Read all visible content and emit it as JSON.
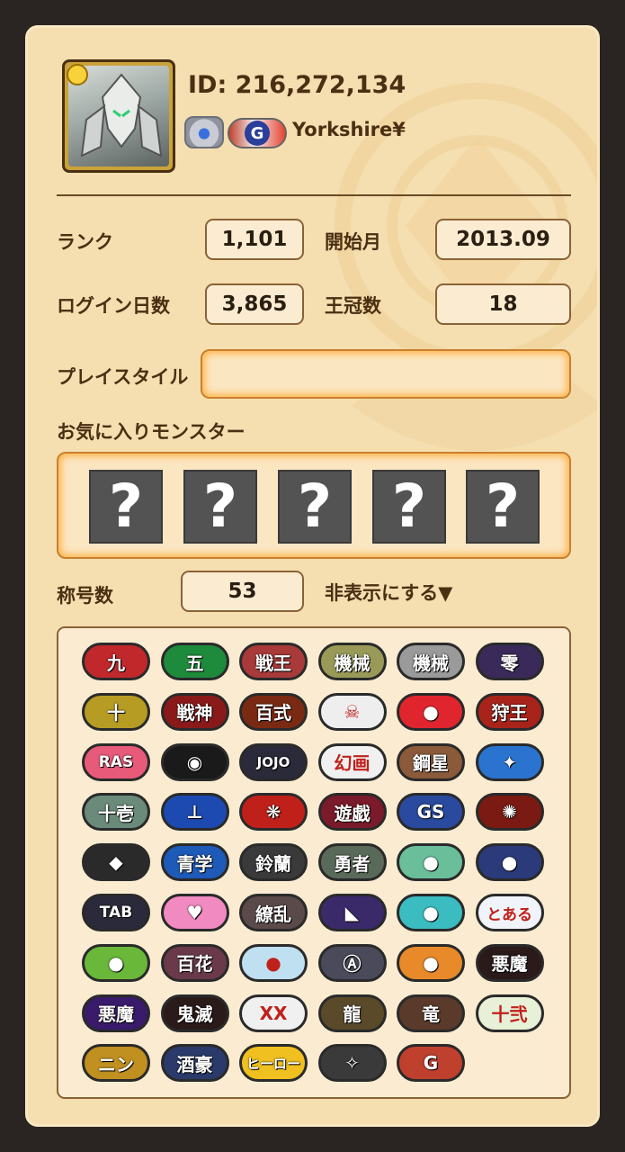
{
  "profile": {
    "id_text": "ID: 216,272,134",
    "name": "Yorkshire¥",
    "avatar_icon": "mecha-dragon-monster-icon",
    "badge_a_icon": "crown-medal-icon",
    "badge_g_icon": "g-emblem-icon",
    "badge_g_letter": "G"
  },
  "stats": {
    "rank_label": "ランク",
    "rank_value": "1,101",
    "start_label": "開始月",
    "start_value": "2013.09",
    "login_label": "ログイン日数",
    "login_value": "3,865",
    "crown_label": "王冠数",
    "crown_value": "18"
  },
  "playstyle": {
    "label": "プレイスタイル",
    "value": ""
  },
  "favorites": {
    "label": "お気に入りモンスター",
    "slots": [
      "?",
      "?",
      "?",
      "?",
      "?"
    ]
  },
  "titles": {
    "count_label": "称号数",
    "count_value": "53",
    "toggle_label": "非表示にする▼",
    "badges": [
      {
        "text": "九",
        "bg": "#c0282c"
      },
      {
        "text": "五",
        "bg": "#1e8a3c"
      },
      {
        "text": "戦王",
        "bg": "#a83a3a"
      },
      {
        "text": "機械",
        "bg": "#9a9a58"
      },
      {
        "text": "機械",
        "bg": "#9a9a9a"
      },
      {
        "text": "零",
        "bg": "#3a2a5a"
      },
      {
        "text": "十",
        "bg": "#b79c24"
      },
      {
        "text": "戦神",
        "bg": "#8a1a1a"
      },
      {
        "text": "百式",
        "bg": "#7a2a12"
      },
      {
        "text": "☠",
        "bg": "#eeeeee"
      },
      {
        "text": "●",
        "bg": "#e0252f"
      },
      {
        "text": "狩王",
        "bg": "#a8241a"
      },
      {
        "text": "RAS",
        "bg": "#e85a7a"
      },
      {
        "text": "◉",
        "bg": "#1a1a1a"
      },
      {
        "text": "JOJO",
        "bg": "#2a2a3a"
      },
      {
        "text": "幻画",
        "bg": "#f0f0f0"
      },
      {
        "text": "鋼星",
        "bg": "#8a5a3a"
      },
      {
        "text": "✦",
        "bg": "#2a74d0"
      },
      {
        "text": "十壱",
        "bg": "#6a8a7a"
      },
      {
        "text": "⊥",
        "bg": "#1d4ab0"
      },
      {
        "text": "❋",
        "bg": "#c0201a"
      },
      {
        "text": "遊戯",
        "bg": "#7a1a2a"
      },
      {
        "text": "GS",
        "bg": "#2a4aa0"
      },
      {
        "text": "✺",
        "bg": "#7a1a12"
      },
      {
        "text": "◆",
        "bg": "#2a2a2a"
      },
      {
        "text": "青学",
        "bg": "#1e5ab8"
      },
      {
        "text": "鈴蘭",
        "bg": "#3a3a3a"
      },
      {
        "text": "勇者",
        "bg": "#5a6a5a"
      },
      {
        "text": "●",
        "bg": "#6abf9a"
      },
      {
        "text": "●",
        "bg": "#2a3a7a"
      },
      {
        "text": "TAB",
        "bg": "#2a2a3a"
      },
      {
        "text": "♥",
        "bg": "#f08ac0"
      },
      {
        "text": "繚乱",
        "bg": "#5a4a4a"
      },
      {
        "text": "◣",
        "bg": "#3a2a6a"
      },
      {
        "text": "●",
        "bg": "#3abcc0"
      },
      {
        "text": "とある",
        "bg": "#f0f4fa"
      },
      {
        "text": "●",
        "bg": "#6ab83a"
      },
      {
        "text": "百花",
        "bg": "#6a3a4a"
      },
      {
        "text": "●",
        "bg": "#bfe0f0"
      },
      {
        "text": "Ⓐ",
        "bg": "#4a4a5a"
      },
      {
        "text": "●",
        "bg": "#e88a2a"
      },
      {
        "text": "悪魔",
        "bg": "#2a1a1a"
      },
      {
        "text": "悪魔",
        "bg": "#3a1a6a"
      },
      {
        "text": "鬼滅",
        "bg": "#2a1a1a"
      },
      {
        "text": "XX",
        "bg": "#f0f0f0"
      },
      {
        "text": "龍",
        "bg": "#5a4a2a"
      },
      {
        "text": "竜",
        "bg": "#5a3a2a"
      },
      {
        "text": "十弐",
        "bg": "#e8f0d8"
      },
      {
        "text": "ニン",
        "bg": "#c09020"
      },
      {
        "text": "酒豪",
        "bg": "#2a3a6a"
      },
      {
        "text": "ヒーロー",
        "bg": "#f0c020"
      },
      {
        "text": "✧",
        "bg": "#3a3a3a"
      },
      {
        "text": "G",
        "bg": "#c0402e"
      }
    ]
  }
}
